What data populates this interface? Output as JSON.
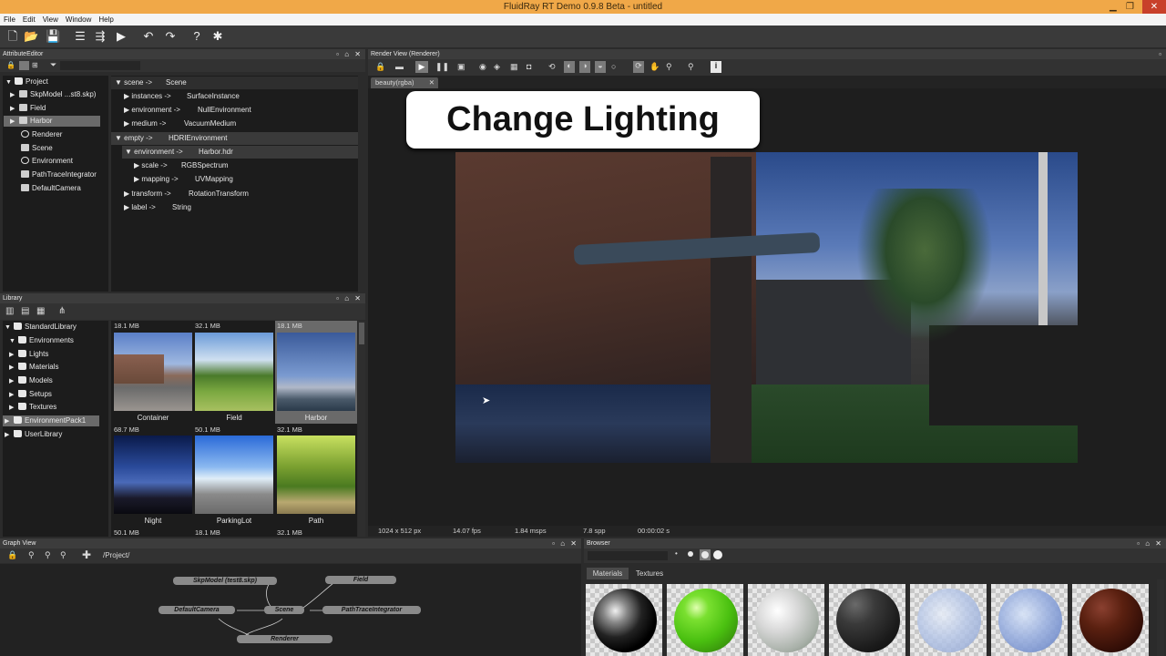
{
  "app": {
    "title": "FluidRay RT Demo 0.9.8 Beta - untitled"
  },
  "menu": [
    "File",
    "Edit",
    "View",
    "Window",
    "Help"
  ],
  "attribute_editor": {
    "title": "AttributeEditor",
    "tree": [
      "Project",
      "SkpModel ...st8.skp)",
      "Field",
      "Harbor",
      "Renderer",
      "Scene",
      "Environment",
      "PathTraceIntegrator",
      "DefaultCamera"
    ],
    "attrs": [
      {
        "name": "scene ->",
        "value": "Scene"
      },
      {
        "name": "instances ->",
        "value": "SurfaceInstance"
      },
      {
        "name": "environment ->",
        "value": "NullEnvironment"
      },
      {
        "name": "medium ->",
        "value": "VacuumMedium"
      },
      {
        "name": "empty ->",
        "value": "HDRIEnvironment"
      },
      {
        "name": "environment ->",
        "value": "Harbor.hdr"
      },
      {
        "name": "scale ->",
        "value": "RGBSpectrum"
      },
      {
        "name": "mapping ->",
        "value": "UVMapping"
      },
      {
        "name": "transform ->",
        "value": "RotationTransform"
      },
      {
        "name": "label ->",
        "value": "String"
      }
    ]
  },
  "library": {
    "title": "Library",
    "tree": [
      "StandardLibrary",
      "Environments",
      "Lights",
      "Materials",
      "Models",
      "Setups",
      "Textures",
      "EnvironmentPack1",
      "UserLibrary"
    ],
    "thumbs": [
      {
        "size": "18.1 MB",
        "label": "Container"
      },
      {
        "size": "32.1 MB",
        "label": "Field"
      },
      {
        "size": "18.1 MB",
        "label": "Harbor"
      },
      {
        "size": "68.7 MB",
        "label": "Night"
      },
      {
        "size": "50.1 MB",
        "label": "ParkingLot"
      },
      {
        "size": "32.1 MB",
        "label": "Path"
      }
    ],
    "next_sizes": [
      "50.1 MB",
      "18.1 MB",
      "32.1 MB"
    ]
  },
  "render_view": {
    "title": "Render View (Renderer)",
    "tab": "beauty(rgba)",
    "overlay_text": "Change Lighting",
    "status": [
      "1024 x 512 px",
      "14.07 fps",
      "1.84 msps",
      "7.8 spp",
      "00:00:02 s"
    ]
  },
  "graph_view": {
    "title": "Graph View",
    "path": "/Project/",
    "nodes": [
      "SkpModel (test8.skp)",
      "Field",
      "DefaultCamera",
      "Scene",
      "PathTraceIntegrator",
      "Renderer"
    ]
  },
  "browser": {
    "title": "Browser",
    "tabs": [
      "Materials",
      "Textures"
    ]
  },
  "colors": {
    "titlebar": "#f0a848",
    "panel_bg": "#2b2b2b",
    "dark_bg": "#1c1c1c",
    "selection": "#6a6a6a"
  }
}
